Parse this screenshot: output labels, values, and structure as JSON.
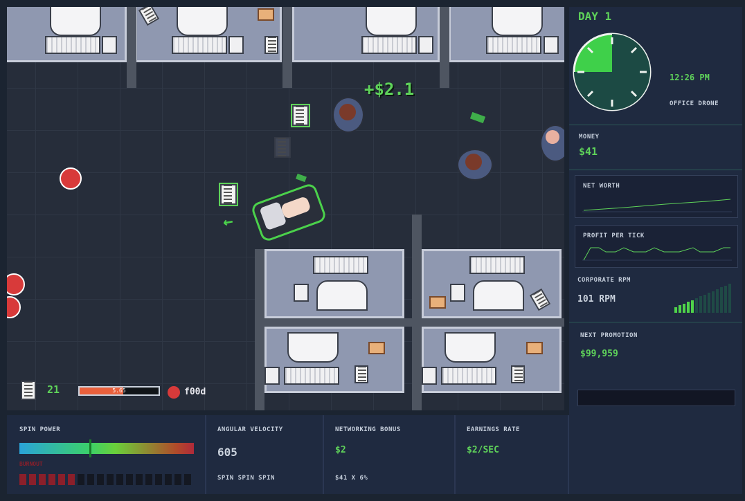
{
  "hud": {
    "float_text": "+$2.1",
    "paper_count": "21",
    "food_bar_value": "5.65",
    "food_bar_fraction": 0.55,
    "food_label": "f00d"
  },
  "sidebar": {
    "day": "DAY 1",
    "time": "12:26 PM",
    "rank": "OFFICE DRONE",
    "money_label": "MONEY",
    "money_value": "$41",
    "net_worth_label": "NET WORTH",
    "profit_label": "PROFIT PER TICK",
    "rpm_label": "CORPORATE RPM",
    "rpm_value": "101 RPM",
    "rpm_bars_lit": 5,
    "rpm_bars_total": 14,
    "promotion_label": "NEXT PROMOTION",
    "promotion_value": "$99,959",
    "promotion_progress": 0.0
  },
  "bottom": {
    "spin_power_label": "SPIN POWER",
    "spin_power_level": 0.4,
    "burnout_label": "BURNOUT",
    "burnout_lit": 6,
    "burnout_total": 18,
    "angular_label": "ANGULAR VELOCITY",
    "angular_value": "605",
    "angular_sub": "SPIN SPIN SPIN",
    "network_label": "NETWORKING BONUS",
    "network_value": "$2",
    "network_sub": "$41 X 6%",
    "earnings_label": "EARNINGS RATE",
    "earnings_value": "$2/SEC"
  },
  "colors": {
    "accent_green": "#5fd35a",
    "panel": "#1f2a40",
    "burnout_red": "#8a1f2a"
  }
}
